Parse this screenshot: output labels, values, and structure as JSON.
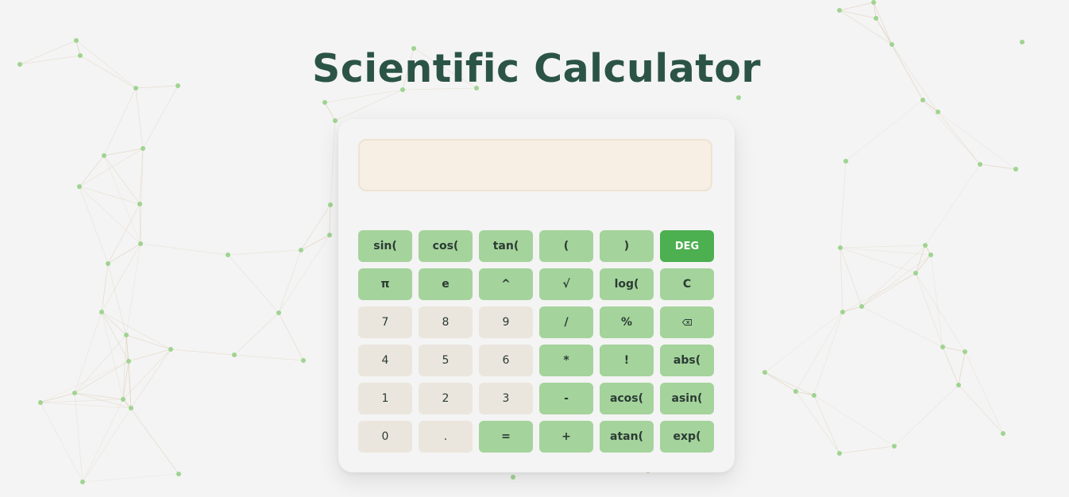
{
  "title": "Scientific Calculator",
  "display": {
    "value": ""
  },
  "colors": {
    "background": "#f4f4f4",
    "title": "#2b5446",
    "function_key": "#a4d39b",
    "number_key": "#ebe6dd",
    "mode_key_active": "#4caf50",
    "display_bg": "#f7efe3",
    "network_node": "#9fd490",
    "network_line": "#dcc9b0"
  },
  "keys": {
    "sin": "sin(",
    "cos": "cos(",
    "tan": "tan(",
    "open_paren": "(",
    "close_paren": ")",
    "deg": "DEG",
    "pi": "π",
    "e": "e",
    "power": "^",
    "sqrt": "√",
    "log": "log(",
    "clear": "C",
    "n7": "7",
    "n8": "8",
    "n9": "9",
    "divide": "/",
    "percent": "%",
    "n4": "4",
    "n5": "5",
    "n6": "6",
    "multiply": "*",
    "factorial": "!",
    "abs": "abs(",
    "n1": "1",
    "n2": "2",
    "n3": "3",
    "minus": "-",
    "acos": "acos(",
    "asin": "asin(",
    "n0": "0",
    "dot": ".",
    "equals": "=",
    "plus": "+",
    "atan": "atan(",
    "exp": "exp("
  },
  "icons": {
    "backspace": "backspace-icon"
  }
}
